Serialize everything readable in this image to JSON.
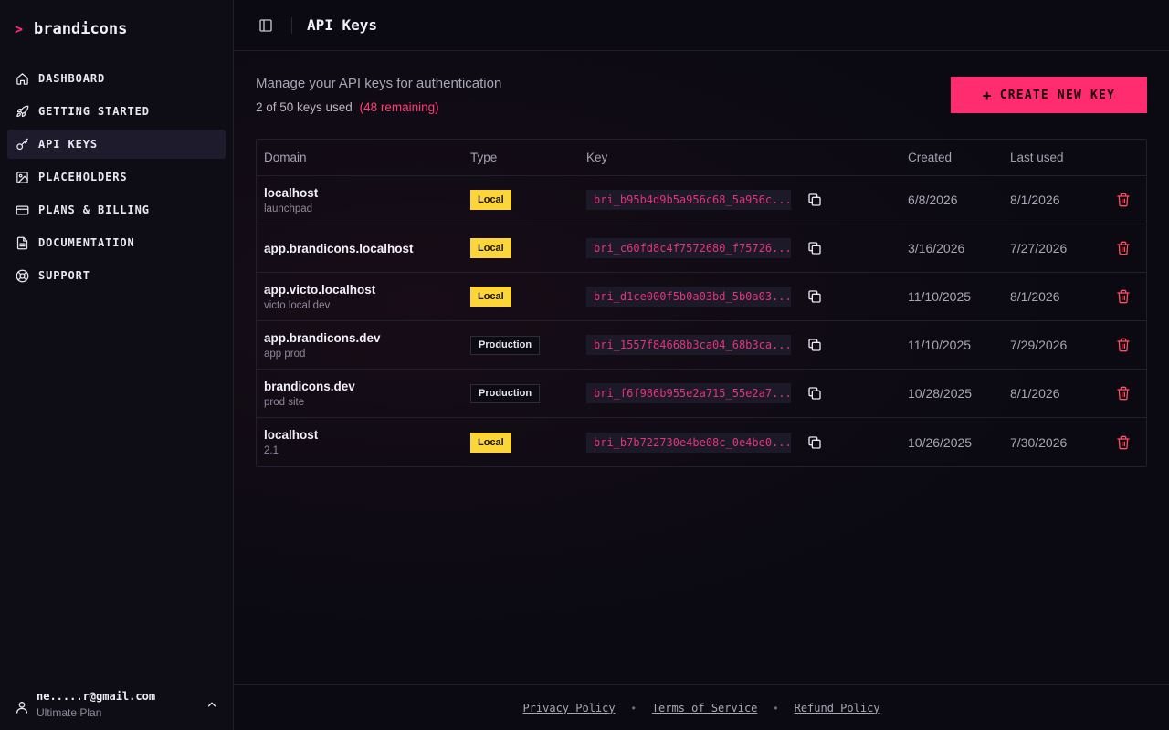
{
  "brand": {
    "chevron": ">",
    "name": "brandicons"
  },
  "sidebar": {
    "items": [
      {
        "label": "DASHBOARD",
        "icon": "home-icon",
        "active": false
      },
      {
        "label": "GETTING STARTED",
        "icon": "rocket-icon",
        "active": false
      },
      {
        "label": "API KEYS",
        "icon": "key-icon",
        "active": true
      },
      {
        "label": "PLACEHOLDERS",
        "icon": "image-icon",
        "active": false
      },
      {
        "label": "PLANS & BILLING",
        "icon": "credit-card-icon",
        "active": false
      },
      {
        "label": "DOCUMENTATION",
        "icon": "document-icon",
        "active": false
      },
      {
        "label": "SUPPORT",
        "icon": "lifebuoy-icon",
        "active": false
      }
    ]
  },
  "user": {
    "email": "ne.....r@gmail.com",
    "plan": "Ultimate Plan"
  },
  "header": {
    "title": "API Keys"
  },
  "main": {
    "subtitle": "Manage your API keys for authentication",
    "usage": "2 of 50 keys used",
    "remaining": "(48 remaining)",
    "create_button": "CREATE NEW KEY",
    "create_icon": "+"
  },
  "table": {
    "columns": [
      "Domain",
      "Type",
      "Key",
      "Created",
      "Last used"
    ],
    "rows": [
      {
        "domain": "localhost",
        "note": "launchpad",
        "type": "Local",
        "key": "bri_b95b4d9b5a956c68_5a956c...",
        "created": "6/8/2026",
        "last_used": "8/1/2026"
      },
      {
        "domain": "app.brandicons.localhost",
        "note": "",
        "type": "Local",
        "key": "bri_c60fd8c4f7572680_f75726...",
        "created": "3/16/2026",
        "last_used": "7/27/2026"
      },
      {
        "domain": "app.victo.localhost",
        "note": "victo local dev",
        "type": "Local",
        "key": "bri_d1ce000f5b0a03bd_5b0a03...",
        "created": "11/10/2025",
        "last_used": "8/1/2026"
      },
      {
        "domain": "app.brandicons.dev",
        "note": "app prod",
        "type": "Production",
        "key": "bri_1557f84668b3ca04_68b3ca...",
        "created": "11/10/2025",
        "last_used": "7/29/2026"
      },
      {
        "domain": "brandicons.dev",
        "note": "prod site",
        "type": "Production",
        "key": "bri_f6f986b955e2a715_55e2a7...",
        "created": "10/28/2025",
        "last_used": "8/1/2026"
      },
      {
        "domain": "localhost",
        "note": "2.1",
        "type": "Local",
        "key": "bri_b7b722730e4be08c_0e4be0...",
        "created": "10/26/2025",
        "last_used": "7/30/2026"
      }
    ]
  },
  "footer": {
    "links": [
      "Privacy Policy",
      "Terms of Service",
      "Refund Policy"
    ],
    "separator": "•"
  },
  "colors": {
    "accent": "#ff2d6f",
    "local_badge": "#fcd53a",
    "key_text": "#e0357a",
    "delete": "#ff4d5e"
  }
}
